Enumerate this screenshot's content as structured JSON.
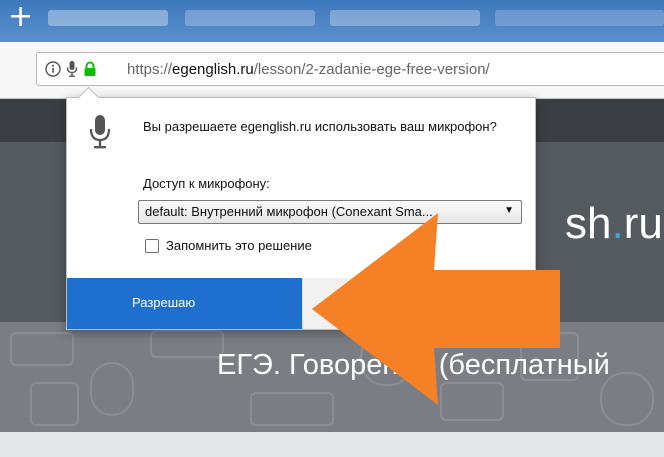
{
  "browser": {
    "new_tab_symbol": "+",
    "url_prefix": "https://",
    "url_domain": "egenglish.ru",
    "url_path": "/lesson/2-zadanie-ege-free-version/"
  },
  "site": {
    "logo_main": "sh",
    "logo_dot": ".",
    "logo_tld": "ru",
    "hero_title": "ЕГЭ. Говорение (бесплатный"
  },
  "permission_popup": {
    "question": "Вы разрешаете egenglish.ru использовать ваш микрофон?",
    "access_label": "Доступ к микрофону:",
    "selected_device": "default: Внутренний микрофон (Conexant Sma...",
    "remember_label": "Запомнить это решение",
    "remember_checked": false,
    "allow_label": "Разрешаю",
    "deny_label": ""
  },
  "colors": {
    "allow_button": "#1f6fcf",
    "annotation_arrow": "#f58025",
    "logo_dot": "#2ab1d8"
  }
}
